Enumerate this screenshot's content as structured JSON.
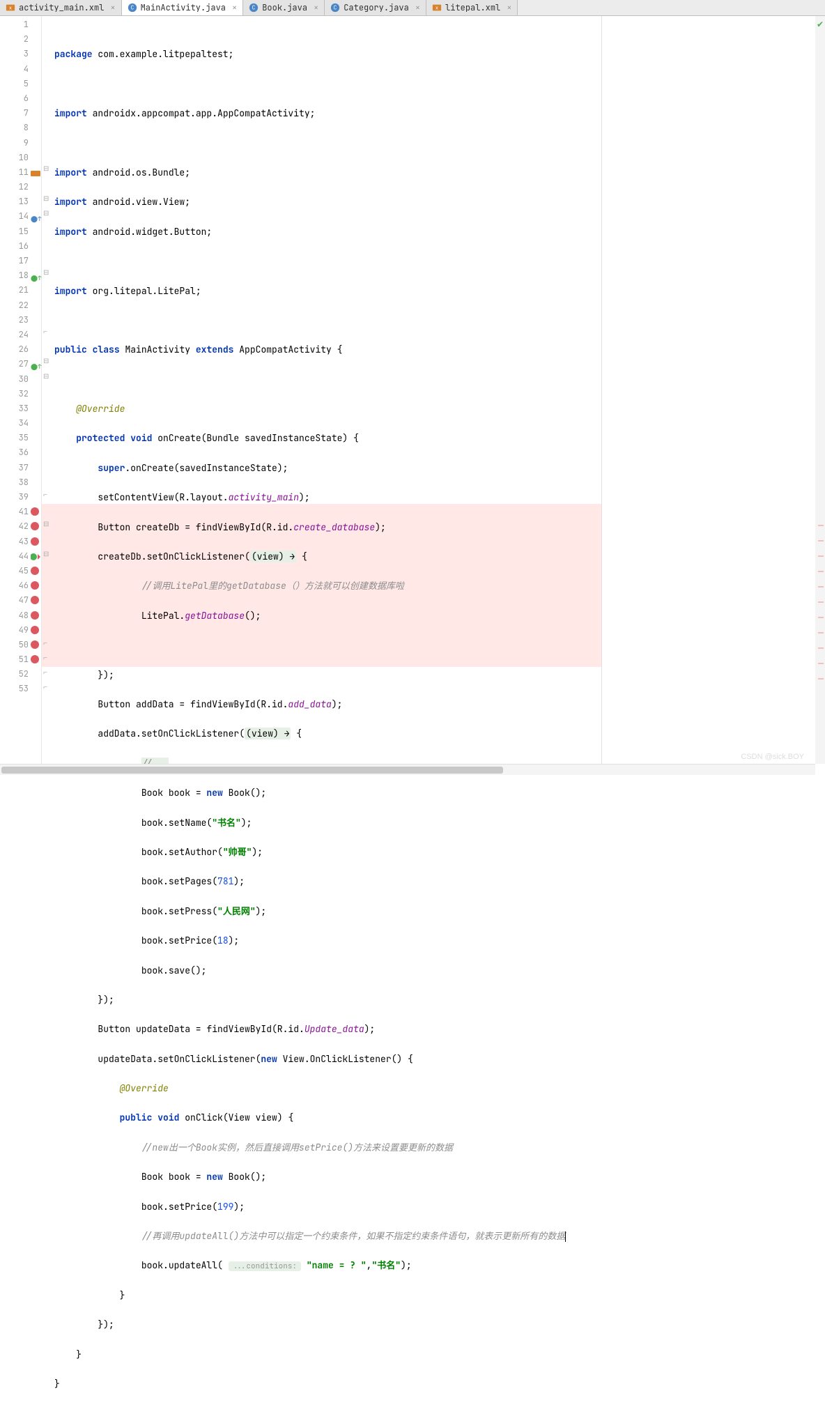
{
  "tabs": [
    {
      "label": "activity_main.xml",
      "icon": "xml",
      "active": false
    },
    {
      "label": "MainActivity.java",
      "icon": "java",
      "active": true
    },
    {
      "label": "Book.java",
      "icon": "java",
      "active": false
    },
    {
      "label": "Category.java",
      "icon": "java",
      "active": false
    },
    {
      "label": "litepal.xml",
      "icon": "xml",
      "active": false
    }
  ],
  "line_numbers": [
    "1",
    "2",
    "3",
    "4",
    "5",
    "6",
    "7",
    "8",
    "9",
    "10",
    "11",
    "12",
    "13",
    "14",
    "15",
    "16",
    "17",
    "18",
    "21",
    "22",
    "23",
    "24",
    "26",
    "27",
    "30",
    "32",
    "33",
    "34",
    "35",
    "36",
    "37",
    "38",
    "39",
    "41",
    "42",
    "43",
    "44",
    "45",
    "46",
    "47",
    "48",
    "49",
    "50",
    "51",
    "52",
    "53"
  ],
  "gutter_markers": {
    "10": "class",
    "13": "override",
    "17": "override-up",
    "26": "override-up",
    "33": "breakpoint",
    "34": "breakpoint",
    "35": "breakpoint",
    "36": "override-bp",
    "37": "breakpoint",
    "38": "breakpoint",
    "39": "breakpoint",
    "40": "breakpoint",
    "41": "breakpoint",
    "42": "breakpoint",
    "43": "breakpoint"
  },
  "code": {
    "l1": {
      "kw1": "package",
      "rest": " com.example.litpepaltest;"
    },
    "l3": {
      "kw1": "import",
      "rest": " androidx.appcompat.app.AppCompatActivity;"
    },
    "l5": {
      "kw1": "import",
      "rest": " android.os.Bundle;"
    },
    "l6": {
      "kw1": "import",
      "rest": " android.view.View;"
    },
    "l7": {
      "kw1": "import",
      "rest": " android.widget.Button;"
    },
    "l9": {
      "kw1": "import",
      "rest": " org.litepal.LitePal;"
    },
    "l11": {
      "kw1": "public",
      "kw2": "class",
      "name": " MainActivity ",
      "kw3": "extends",
      "rest": " AppCompatActivity {"
    },
    "l13": {
      "ann": "@Override"
    },
    "l14": {
      "kw1": "protected",
      "kw2": "void",
      "name": " onCreate",
      "rest": "(Bundle savedInstanceState) {"
    },
    "l15": {
      "kw1": "super",
      "rest": ".onCreate(savedInstanceState);"
    },
    "l16": {
      "pre": "setContentView(R.layout.",
      "field": "activity_main",
      "post": ");"
    },
    "l17": {
      "pre": "Button createDb = findViewById(R.id.",
      "field": "create_database",
      "post": ");"
    },
    "l18": {
      "pre": "createDb.setOnClickListener(",
      "hint": "(view) →",
      "post": " {"
    },
    "l21": {
      "comment": "//调用LitePal里的getDatabase（）方法就可以创建数据库啦"
    },
    "l22": {
      "pre": "LitePal.",
      "field": "getDatabase",
      "post": "();"
    },
    "l24": {
      "text": "});"
    },
    "l26": {
      "pre": "Button addData = findViewById(R.id.",
      "field": "add_data",
      "post": ");"
    },
    "l27": {
      "pre": "addData.setOnClickListener(",
      "hint": "(view) →",
      "post": " {"
    },
    "l30": {
      "comment": "//..."
    },
    "l32": {
      "pre": "Book book = ",
      "kw": "new",
      "post": " Book();"
    },
    "l33": {
      "pre": "book.setName(",
      "str": "\"书名\"",
      "post": ");"
    },
    "l34": {
      "pre": "book.setAuthor(",
      "str": "\"帅哥\"",
      "post": ");"
    },
    "l35": {
      "pre": "book.setPages(",
      "num": "781",
      "post": ");"
    },
    "l36": {
      "pre": "book.setPress(",
      "str": "\"人民网\"",
      "post": ");"
    },
    "l37": {
      "pre": "book.setPrice(",
      "num": "18",
      "post": ");"
    },
    "l38": {
      "text": "book.save();"
    },
    "l39": {
      "text": "});"
    },
    "l41": {
      "pre": "Button updateData = findViewById(R.id.",
      "field": "Update_data",
      "post": ");"
    },
    "l42": {
      "pre": "updateData.setOnClickListener(",
      "kw": "new",
      "post": " View.OnClickListener() {"
    },
    "l43": {
      "ann": "@Override"
    },
    "l44": {
      "kw1": "public",
      "kw2": "void",
      "name": " onClick",
      "rest": "(View view) {"
    },
    "l45": {
      "comment": "//new出一个Book实例，然后直接调用setPrice()方法来设置要更新的数据"
    },
    "l46": {
      "pre": "Book book = ",
      "kw": "new",
      "post": " Book();"
    },
    "l47": {
      "pre": "book.setPrice(",
      "num": "199",
      "post": ");"
    },
    "l48": {
      "comment": "//再调用updateAll()方法中可以指定一个约束条件，如果不指定约束条件语句，就表示更新所有的数据"
    },
    "l49": {
      "pre": "book.updateAll( ",
      "hint": "...conditions:",
      "str1": " \"name = ? \"",
      "mid": ",",
      "str2": "\"书名\"",
      "post": ");"
    },
    "l50": {
      "text": "}"
    },
    "l51": {
      "text": "});"
    },
    "l52": {
      "text": "}"
    },
    "l53": {
      "text": "}"
    }
  },
  "watermark": "CSDN @sick.BOY"
}
